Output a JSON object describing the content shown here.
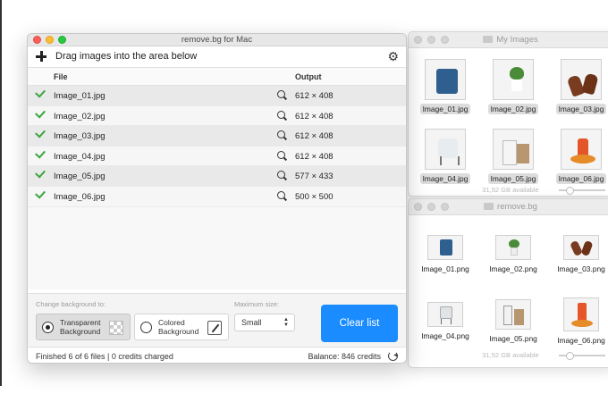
{
  "app": {
    "title": "remove.bg for Mac"
  },
  "toolbar": {
    "hint": "Drag images into the area below"
  },
  "table": {
    "headers": {
      "file": "File",
      "output": "Output"
    },
    "rows": [
      {
        "file": "Image_01.jpg",
        "output": "612 × 408"
      },
      {
        "file": "Image_02.jpg",
        "output": "612 × 408"
      },
      {
        "file": "Image_03.jpg",
        "output": "612 × 408"
      },
      {
        "file": "Image_04.jpg",
        "output": "612 × 408"
      },
      {
        "file": "Image_05.jpg",
        "output": "577 × 433"
      },
      {
        "file": "Image_06.jpg",
        "output": "500 × 500"
      }
    ]
  },
  "controls": {
    "background_label": "Change background to:",
    "transparent": {
      "line1": "Transparent",
      "line2": "Background",
      "selected": true
    },
    "colored": {
      "line1": "Colored",
      "line2": "Background",
      "selected": false
    },
    "max_size_label": "Maximum size:",
    "max_size_value": "Small",
    "clear_button": "Clear list"
  },
  "footer": {
    "status": "Finished 6 of 6 files | 0 credits charged",
    "balance": "Balance: 846 credits"
  },
  "finder_top": {
    "title": "My Images",
    "items": [
      "Image_01.jpg",
      "Image_02.jpg",
      "Image_03.jpg",
      "Image_04.jpg",
      "Image_05.jpg",
      "Image_06.jpg"
    ],
    "status": "31,52 GB available"
  },
  "finder_bottom": {
    "title": "remove.bg",
    "items": [
      "Image_01.png",
      "Image_02.png",
      "Image_03.png",
      "Image_04.png",
      "Image_05.png",
      "Image_06.png"
    ],
    "status": "31,52 GB available"
  },
  "colors": {
    "accent": "#1a8cff",
    "check": "#3aa53a"
  },
  "icons": {
    "add": "plus-icon",
    "settings": "gear-icon",
    "preview": "magnifier-icon",
    "refresh": "refresh-icon"
  }
}
